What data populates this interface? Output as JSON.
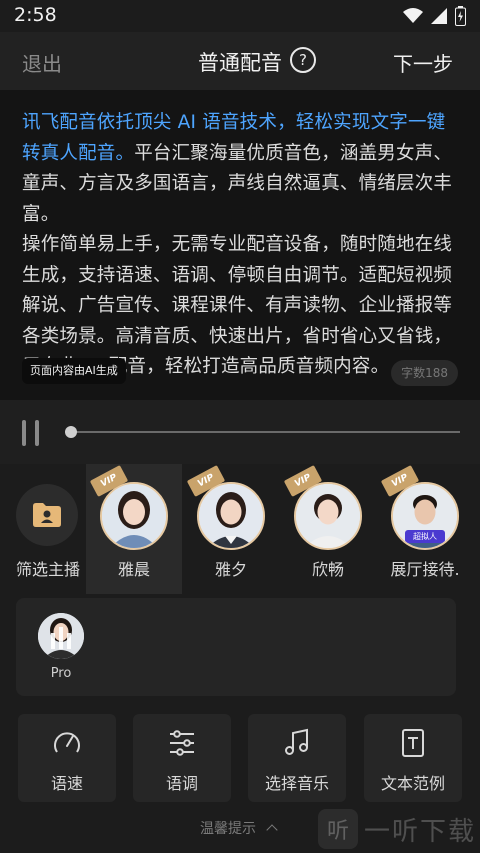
{
  "status": {
    "time": "2:58"
  },
  "header": {
    "exit_label": "退出",
    "title": "普通配音",
    "help_glyph": "?",
    "next_label": "下一步"
  },
  "script": {
    "highlight": "讯飞配音依托顶尖 AI 语音技术，轻松实现文字一键转真人配音。",
    "body": "平台汇聚海量优质音色，涵盖男女声、童声、方言及多国语言，声线自然逼真、情绪层次丰富。",
    "body2": "操作简单易上手，无需专业配音设备，随时随地在线生成，支持语速、语调、停顿自由调节。适配短视频解说、广告宣传、课程课件、有声读物、企业播报等各类场景。高清音质、快速出片，省时省心又省钱，用专业 AI 配音，轻松打造高品质音频内容。",
    "ai_badge": "页面内容由AI生成",
    "char_count": "字数188"
  },
  "player": {
    "progress": 0.0
  },
  "voices": {
    "filter_label": "筛选主播",
    "items": [
      {
        "name": "雅晨",
        "vip": "VIP",
        "selected": true
      },
      {
        "name": "雅夕",
        "vip": "VIP",
        "selected": false
      },
      {
        "name": "欣畅",
        "vip": "VIP",
        "selected": false
      },
      {
        "name": "展厅接待.",
        "vip": "VIP",
        "tag": "超拟人",
        "selected": false
      }
    ]
  },
  "pro": {
    "label": "Pro"
  },
  "tools": [
    {
      "label": "语速",
      "icon": "gauge-icon"
    },
    {
      "label": "语调",
      "icon": "sliders-icon"
    },
    {
      "label": "选择音乐",
      "icon": "music-note-icon"
    },
    {
      "label": "文本范例",
      "icon": "text-document-icon"
    }
  ],
  "footer": {
    "tips_label": "温馨提示",
    "watermark": "一听下载",
    "watermark_glyph": "听"
  },
  "colors": {
    "accent_blue": "#4ea5ff",
    "vip_gold": "#c9a36b",
    "background": "#1c1c1c"
  }
}
